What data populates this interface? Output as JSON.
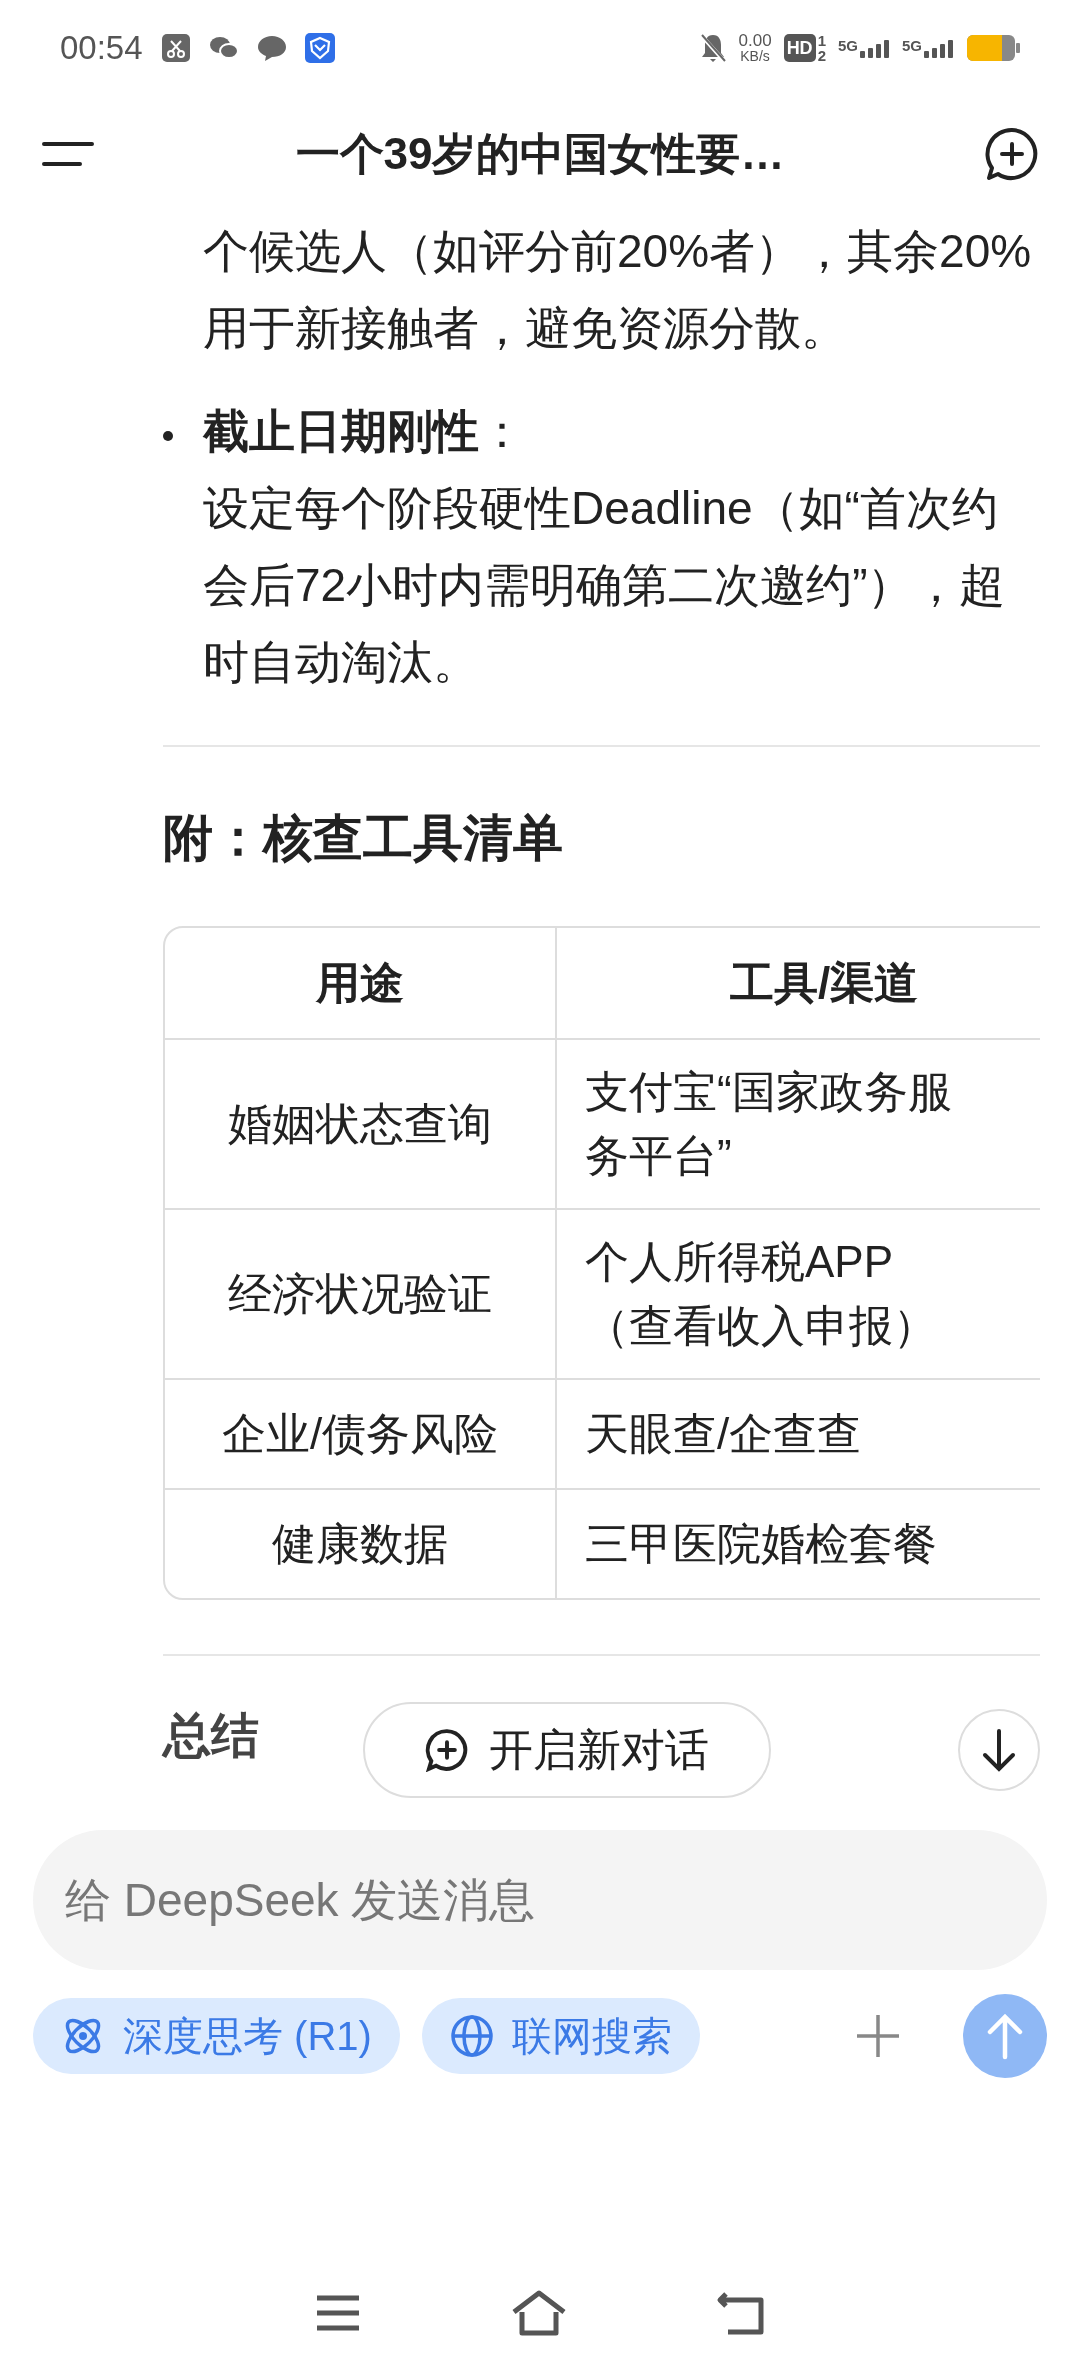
{
  "status_bar": {
    "time": "00:54",
    "net_speed": "0.00",
    "net_unit": "KB/s",
    "hd_label": "HD",
    "sim_1": "1",
    "sim_2": "2",
    "signal_1": "5G",
    "signal_2": "5G"
  },
  "header": {
    "title": "一个39岁的中国女性要…"
  },
  "content": {
    "paragraph": "个候选人（如评分前20%者），其余20%用于新接触者，避免资源分散。",
    "bullets": [
      {
        "title": "**截止日期刚性**：",
        "text": "设定每个阶段硬性Deadline（如“首次约会后72小时内需明确第二次邀约”），超时自动淘汰。"
      }
    ],
    "section_heading": "附：核查工具清单",
    "table": {
      "columns": [
        "用途",
        "工具/渠道"
      ],
      "rows": [
        [
          "婚姻状态查询",
          "支付宝“国家政务服务平台”"
        ],
        [
          "经济状况验证",
          "个人所得税APP（查看收入申报）"
        ],
        [
          "企业/债务风险",
          "天眼查/企查查"
        ],
        [
          "健康数据",
          "三甲医院婚检套餐"
        ]
      ]
    },
    "next_heading": "总结"
  },
  "new_chat_button": "开启新对话",
  "composer": {
    "placeholder": "给 DeepSeek 发送消息",
    "chips": [
      {
        "kind": "think",
        "label": "深度思考 (R1)",
        "selected": true
      },
      {
        "kind": "search",
        "label": "联网搜索",
        "selected": true
      }
    ]
  }
}
